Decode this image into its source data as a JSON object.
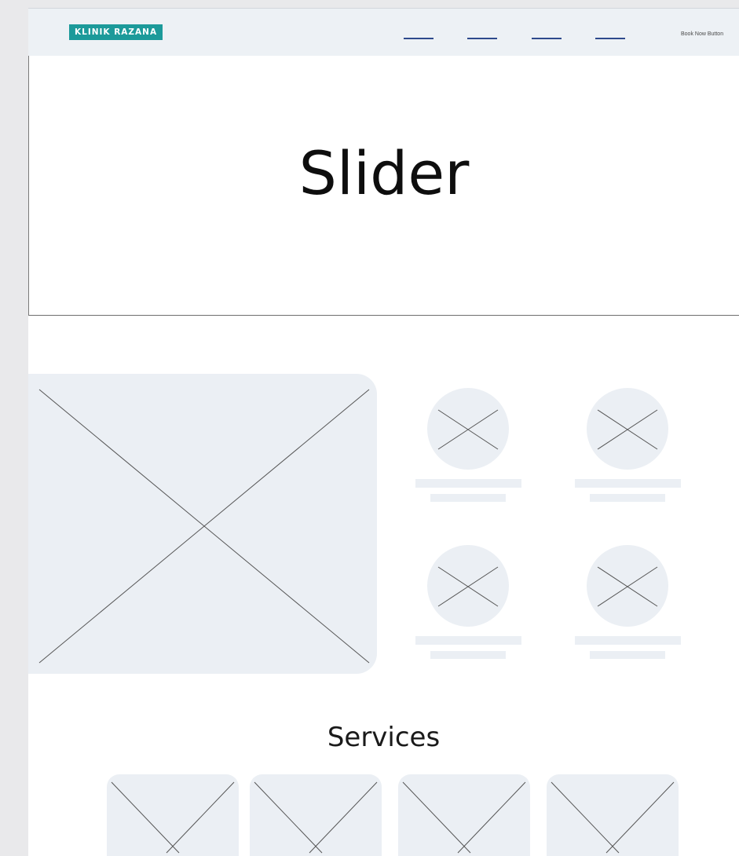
{
  "header": {
    "brand": "KLINIK RAZANA",
    "book_button": "Book Now Button",
    "nav_links": 4
  },
  "hero": {
    "title": "Slider"
  },
  "sections": {
    "services_title": "Services"
  },
  "colors": {
    "brand": "#1c9a9a",
    "nav_link": "#2e4a8c",
    "placeholder": "#ebeff4",
    "header_bg": "#edf1f5"
  },
  "icons": {
    "image_placeholder": "image-placeholder-icon"
  }
}
